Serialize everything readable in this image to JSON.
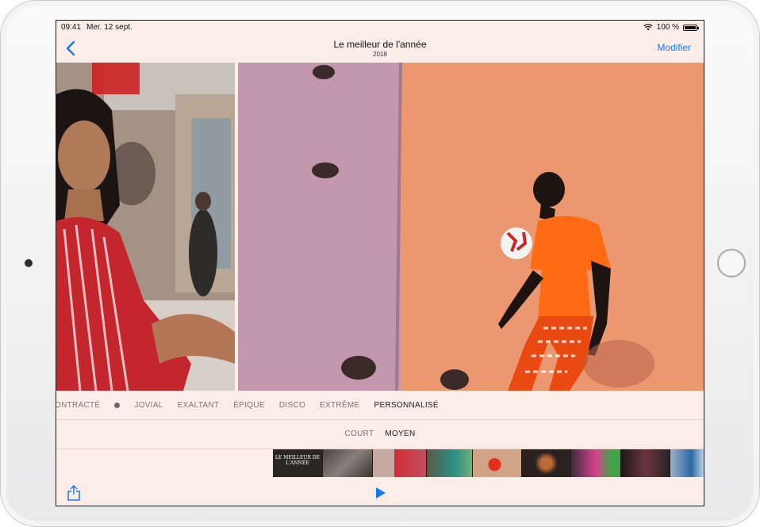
{
  "status_bar": {
    "time": "09:41",
    "date": "Mer. 12 sept.",
    "battery": "100 %",
    "battery_level": 1.0,
    "wifi_icon": "wifi-icon"
  },
  "nav": {
    "back_icon": "chevron-left-icon",
    "title": "Le meilleur de l'année",
    "subtitle": "2018",
    "edit_label": "Modifier"
  },
  "styles": {
    "items": [
      "ONTRACTÉ",
      "JOVIAL",
      "EXALTANT",
      "ÉPIQUE",
      "DISCO",
      "EXTRÊME",
      "PERSONNALISÉ"
    ],
    "selected": "PERSONNALISÉ"
  },
  "lengths": {
    "items": [
      "COURT",
      "MOYEN"
    ],
    "selected": "MOYEN"
  },
  "filmstrip": {
    "title_card": "LE MEILLEUR DE L'ANNÉE"
  },
  "toolbar": {
    "share_icon": "share-icon",
    "play_icon": "play-icon"
  },
  "colors": {
    "accent": "#1478f5",
    "background": "#fbeee8"
  }
}
